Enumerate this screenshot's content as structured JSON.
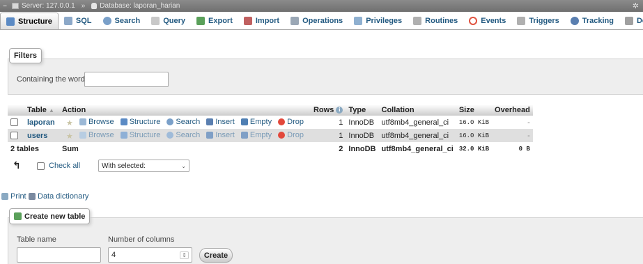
{
  "breadcrumb": {
    "server": "Server: 127.0.0.1",
    "separator": "»",
    "database": "Database: laporan_harian"
  },
  "tabs": [
    {
      "label": "Structure",
      "icon": "structure-icon",
      "color": "#5b8ac4",
      "active": true
    },
    {
      "label": "SQL",
      "icon": "sql-icon",
      "color": "#8ca8c8"
    },
    {
      "label": "Search",
      "icon": "search-icon",
      "color": "#7aa0c9"
    },
    {
      "label": "Query",
      "icon": "query-icon",
      "color": "#c8c8c8"
    },
    {
      "label": "Export",
      "icon": "export-icon",
      "color": "#5aa05a"
    },
    {
      "label": "Import",
      "icon": "import-icon",
      "color": "#c06060"
    },
    {
      "label": "Operations",
      "icon": "wrench-icon",
      "color": "#9aa7b5"
    },
    {
      "label": "Privileges",
      "icon": "privileges-icon",
      "color": "#8fb0d0"
    },
    {
      "label": "Routines",
      "icon": "routines-icon",
      "color": "#b0b0b0"
    },
    {
      "label": "Events",
      "icon": "events-icon",
      "color": "#e0523f"
    },
    {
      "label": "Triggers",
      "icon": "triggers-icon",
      "color": "#b0b0b0"
    },
    {
      "label": "Tracking",
      "icon": "tracking-icon",
      "color": "#5a7fb0"
    },
    {
      "label": "Designer",
      "icon": "designer-icon",
      "color": "#a0a0a0"
    }
  ],
  "filters": {
    "legend": "Filters",
    "label": "Containing the word:",
    "value": ""
  },
  "table": {
    "headers": {
      "table": "Table",
      "sort_arrow": "▲",
      "action": "Action",
      "rows": "Rows",
      "type": "Type",
      "collation": "Collation",
      "size": "Size",
      "overhead": "Overhead"
    },
    "actions": {
      "browse": "Browse",
      "structure": "Structure",
      "search": "Search",
      "insert": "Insert",
      "empty": "Empty",
      "drop": "Drop"
    },
    "rows": [
      {
        "name": "laporan",
        "rows": "1",
        "type": "InnoDB",
        "collation": "utf8mb4_general_ci",
        "size": "16.0 KiB",
        "overhead": "-"
      },
      {
        "name": "users",
        "rows": "1",
        "type": "InnoDB",
        "collation": "utf8mb4_general_ci",
        "size": "16.0 KiB",
        "overhead": "-"
      }
    ],
    "summary": {
      "tables": "2 tables",
      "label": "Sum",
      "rows": "2",
      "type": "InnoDB",
      "collation": "utf8mb4_general_ci",
      "size": "32.0 KiB",
      "overhead": "0 B"
    }
  },
  "bulk": {
    "check_all": "Check all",
    "with_selected": "With selected:"
  },
  "links": {
    "print": "Print",
    "data_dictionary": "Data dictionary"
  },
  "create": {
    "legend": "Create new table",
    "table_name_label": "Table name",
    "table_name_value": "",
    "columns_label": "Number of columns",
    "columns_value": "4",
    "button": "Create"
  }
}
